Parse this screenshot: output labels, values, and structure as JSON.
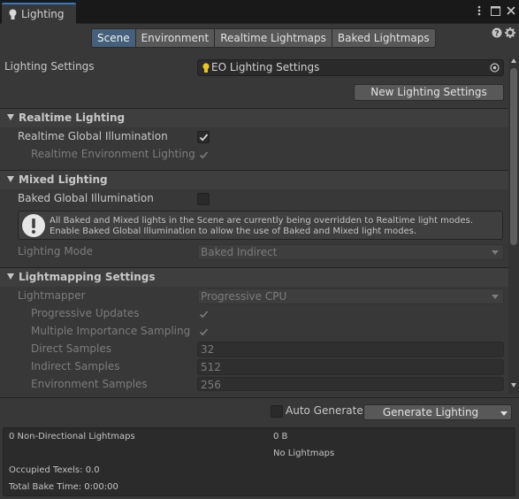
{
  "window": {
    "tab_label": "Lighting",
    "tab_icon": "lightbulb-icon",
    "menu_icon": "kebab-menu-icon",
    "maximize_icon": "maximize-icon",
    "close_icon": "close-icon",
    "help_icon": "help-icon",
    "settings_icon": "gear-icon",
    "accent_color": "#3a79bb"
  },
  "section_tabs": [
    {
      "label": "Scene",
      "active": true
    },
    {
      "label": "Environment",
      "active": false
    },
    {
      "label": "Realtime Lightmaps",
      "active": false
    },
    {
      "label": "Baked Lightmaps",
      "active": false
    }
  ],
  "lighting_settings": {
    "label": "Lighting Settings",
    "asset": "EO Lighting Settings",
    "new_button": "New Lighting Settings"
  },
  "realtime_lighting": {
    "title": "Realtime Lighting",
    "gi_label": "Realtime Global Illumination",
    "gi_checked": true,
    "env_label": "Realtime Environment Lighting",
    "env_checked": true
  },
  "mixed_lighting": {
    "title": "Mixed Lighting",
    "baked_gi_label": "Baked Global Illumination",
    "baked_gi_checked": false,
    "help_text": "All Baked and Mixed lights in the Scene are currently being overridden to Realtime light modes. Enable Baked Global Illumination to allow the use of Baked and Mixed light modes.",
    "mode_label": "Lighting Mode",
    "mode_value": "Baked Indirect"
  },
  "lightmapping": {
    "title": "Lightmapping Settings",
    "lightmapper_label": "Lightmapper",
    "lightmapper_value": "Progressive CPU",
    "progressive_updates_label": "Progressive Updates",
    "progressive_updates_checked": true,
    "mis_label": "Multiple Importance Sampling",
    "mis_checked": true,
    "direct_label": "Direct Samples",
    "direct_value": "32",
    "indirect_label": "Indirect Samples",
    "indirect_value": "512",
    "environment_label": "Environment Samples",
    "environment_value": "256"
  },
  "generate": {
    "auto_label": "Auto Generate",
    "auto_checked": false,
    "button_label": "Generate Lighting"
  },
  "stats": {
    "lightmaps_label": "0 Non-Directional Lightmaps",
    "size": "0 B",
    "no_lightmaps": "No Lightmaps",
    "occupied_texels": "Occupied Texels: 0.0",
    "bake_time": "Total Bake Time: 0:00:00"
  }
}
